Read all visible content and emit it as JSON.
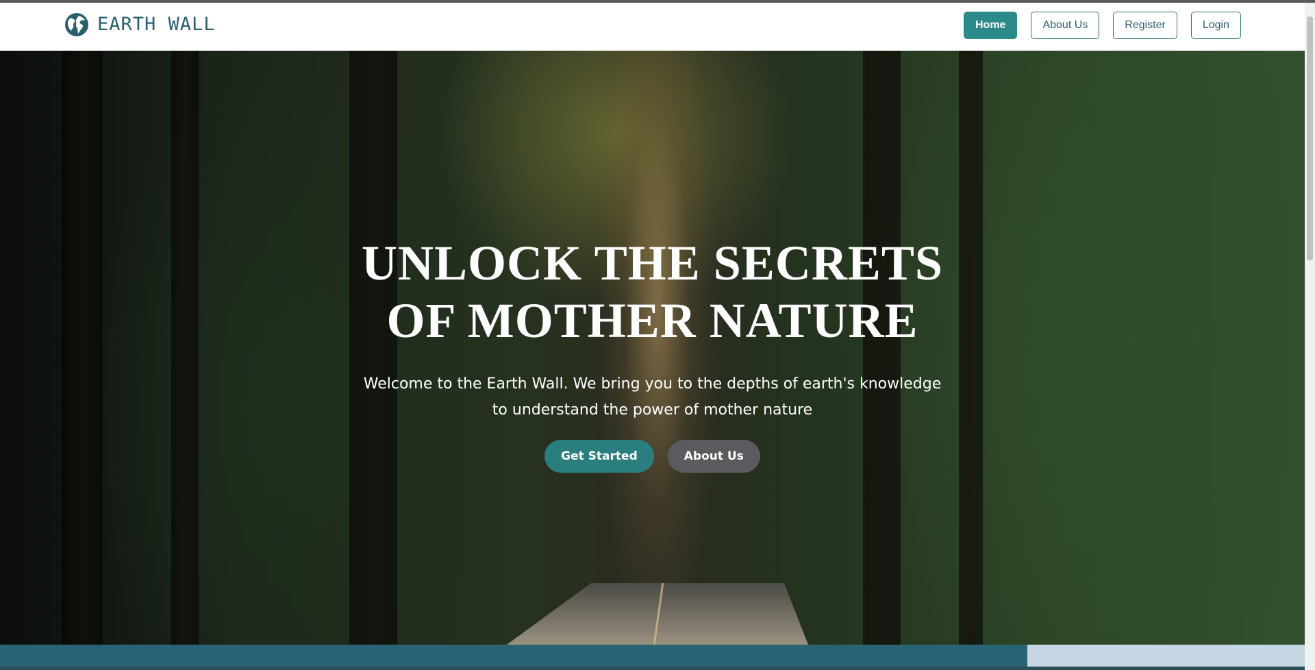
{
  "navbar": {
    "brand": {
      "name": "EARTH WALL",
      "icon": "globe-icon"
    },
    "links": [
      {
        "label": "Home",
        "active": true
      },
      {
        "label": "About Us",
        "active": false
      },
      {
        "label": "Register",
        "active": false
      },
      {
        "label": "Login",
        "active": false
      }
    ]
  },
  "hero": {
    "title": "UNLOCK THE SECRETS OF MOTHER NATURE",
    "subtitle": "Welcome to the Earth Wall. We bring you to the depths of earth's knowledge to understand the power of mother nature",
    "buttons": {
      "primary": "Get Started",
      "secondary": "About Us"
    }
  },
  "colors": {
    "brand": "#2a5f6d",
    "accent": "#2b8a8a",
    "primary_button": "#2b7e80",
    "secondary_button": "#5b5b5f"
  }
}
